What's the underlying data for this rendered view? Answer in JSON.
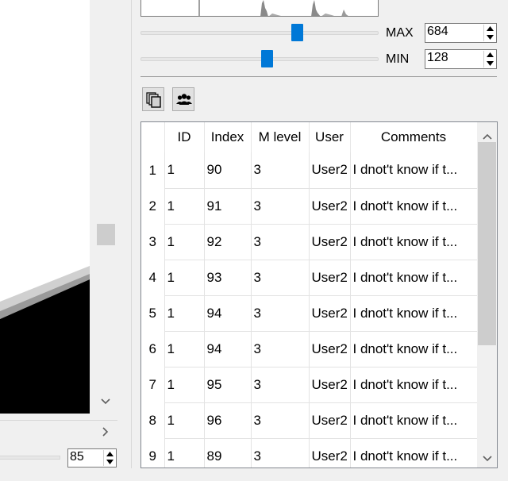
{
  "viewer": {
    "zoom_value": "85",
    "icons": {
      "scroll_down": "chevron-down-icon",
      "scroll_right": "chevron-right-icon"
    }
  },
  "levels": {
    "max_label": "MAX",
    "max_value": "684",
    "min_label": "MIN",
    "min_value": "128",
    "max_slider_level": 0.66,
    "min_slider_level": 0.53
  },
  "toolbar": {
    "buttons": [
      {
        "icon": "copy-pages-icon"
      },
      {
        "icon": "users-group-icon"
      }
    ]
  },
  "table": {
    "columns": [
      "",
      "ID",
      "Index",
      "M level",
      "User",
      "Comments"
    ],
    "rows": [
      {
        "n": "1",
        "id": "1",
        "index": "90",
        "mlevel": "3",
        "user": "User2",
        "comments": "I dnot't know if t..."
      },
      {
        "n": "2",
        "id": "1",
        "index": "91",
        "mlevel": "3",
        "user": "User2",
        "comments": "I dnot't know if t..."
      },
      {
        "n": "3",
        "id": "1",
        "index": "92",
        "mlevel": "3",
        "user": "User2",
        "comments": "I dnot't know if t..."
      },
      {
        "n": "4",
        "id": "1",
        "index": "93",
        "mlevel": "3",
        "user": "User2",
        "comments": "I dnot't know if t..."
      },
      {
        "n": "5",
        "id": "1",
        "index": "94",
        "mlevel": "3",
        "user": "User2",
        "comments": "I dnot't know if t..."
      },
      {
        "n": "6",
        "id": "1",
        "index": "94",
        "mlevel": "3",
        "user": "User2",
        "comments": "I dnot't know if t..."
      },
      {
        "n": "7",
        "id": "1",
        "index": "95",
        "mlevel": "3",
        "user": "User2",
        "comments": "I dnot't know if t..."
      },
      {
        "n": "8",
        "id": "1",
        "index": "96",
        "mlevel": "3",
        "user": "User2",
        "comments": "I dnot't know if t..."
      },
      {
        "n": "9",
        "id": "1",
        "index": "89",
        "mlevel": "3",
        "user": "User2",
        "comments": "I dnot't know if t..."
      }
    ]
  },
  "colors": {
    "accent": "#0078d7",
    "panel_bg": "#f0f0f0"
  }
}
